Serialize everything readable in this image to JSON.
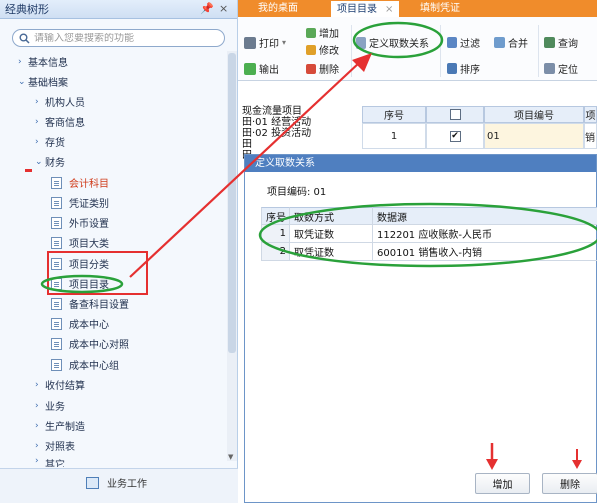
{
  "nav": {
    "title": "经典树形",
    "pin_glyph": "▾",
    "close_glyph": "×",
    "search_placeholder": "请输入您要搜索的功能",
    "items": [
      {
        "label": "基本信息",
        "arrow": "›"
      },
      {
        "label": "基础档案",
        "arrow": "⌄"
      },
      {
        "label": "机构人员",
        "arrow": "›"
      },
      {
        "label": "客商信息",
        "arrow": "›"
      },
      {
        "label": "存货",
        "arrow": "›"
      },
      {
        "label": "财务",
        "arrow": "⌄"
      },
      {
        "label": "会计科目"
      },
      {
        "label": "凭证类别"
      },
      {
        "label": "外币设置"
      },
      {
        "label": "项目大类"
      },
      {
        "label": "项目分类"
      },
      {
        "label": "项目目录"
      },
      {
        "label": "备查科目设置"
      },
      {
        "label": "成本中心"
      },
      {
        "label": "成本中心对照"
      },
      {
        "label": "成本中心组"
      },
      {
        "label": "收付结算",
        "arrow": "›"
      },
      {
        "label": "业务",
        "arrow": "›"
      },
      {
        "label": "生产制造",
        "arrow": "›"
      },
      {
        "label": "对照表",
        "arrow": "›"
      },
      {
        "label": "其它",
        "arrow": "›"
      }
    ],
    "bottom_label": "业务工作"
  },
  "tabs": [
    {
      "label": "我的桌面"
    },
    {
      "label": "项目目录",
      "close": "×"
    },
    {
      "label": "填制凭证"
    }
  ],
  "toolbar": {
    "print": "打印",
    "output": "输出",
    "add": "增加",
    "edit": "修改",
    "delete": "删除",
    "define": "定义取数关系",
    "filter": "过滤",
    "merge": "合并",
    "query": "查询",
    "sort": "排序",
    "locate": "定位"
  },
  "grid": {
    "left_lines": [
      "现金流量项目",
      "田·01 经营活动",
      "田·02 投资活动",
      "田",
      "田"
    ],
    "headers": [
      "序号",
      "",
      "项目编号",
      "项"
    ],
    "row": {
      "index": "1",
      "checked": "✔",
      "code": "01",
      "tail": "销"
    }
  },
  "dialog": {
    "title": "定义取数关系",
    "code_line": "项目编码: 01",
    "headers": [
      "序号",
      "取数方式",
      "数据源"
    ],
    "rows": [
      {
        "index": "1",
        "method": "取凭证数",
        "source": "112201 应收账款-人民币"
      },
      {
        "index": "2",
        "method": "取凭证数",
        "source": "600101 销售收入-内销"
      }
    ],
    "add_button": "增加",
    "delete_button": "删除"
  }
}
